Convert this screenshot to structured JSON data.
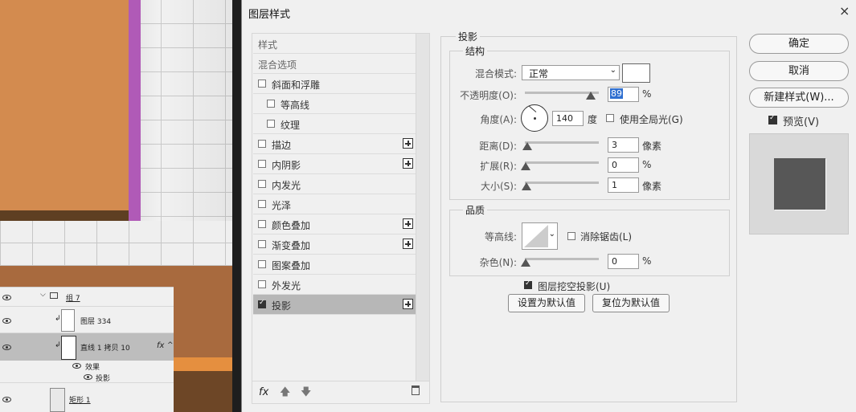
{
  "dialog": {
    "title": "图层样式",
    "close_glyph": "×"
  },
  "style_list": {
    "header": "样式",
    "blend_options": "混合选项",
    "items": [
      {
        "label": "斜面和浮雕",
        "checked": false,
        "plus": false,
        "indent": false
      },
      {
        "label": "等高线",
        "checked": false,
        "plus": false,
        "indent": true
      },
      {
        "label": "纹理",
        "checked": false,
        "plus": false,
        "indent": true
      },
      {
        "label": "描边",
        "checked": false,
        "plus": true,
        "indent": false
      },
      {
        "label": "内阴影",
        "checked": false,
        "plus": true,
        "indent": false
      },
      {
        "label": "内发光",
        "checked": false,
        "plus": false,
        "indent": false
      },
      {
        "label": "光泽",
        "checked": false,
        "plus": false,
        "indent": false
      },
      {
        "label": "颜色叠加",
        "checked": false,
        "plus": true,
        "indent": false
      },
      {
        "label": "渐变叠加",
        "checked": false,
        "plus": true,
        "indent": false
      },
      {
        "label": "图案叠加",
        "checked": false,
        "plus": false,
        "indent": false
      },
      {
        "label": "外发光",
        "checked": false,
        "plus": false,
        "indent": false
      },
      {
        "label": "投影",
        "checked": true,
        "plus": true,
        "indent": false,
        "selected": true
      }
    ],
    "footer_fx": "fx"
  },
  "drop_shadow": {
    "title": "投影",
    "structure_title": "结构",
    "blend_mode_label": "混合模式:",
    "blend_mode_value": "正常",
    "shadow_color": "#ffffff",
    "opacity_label": "不透明度(O):",
    "opacity_value": "89",
    "opacity_unit": "%",
    "angle_label": "角度(A):",
    "angle_value": "140",
    "angle_unit": "度",
    "global_light_label": "使用全局光(G)",
    "global_light_checked": false,
    "distance_label": "距离(D):",
    "distance_value": "3",
    "distance_unit": "像素",
    "spread_label": "扩展(R):",
    "spread_value": "0",
    "spread_unit": "%",
    "size_label": "大小(S):",
    "size_value": "1",
    "size_unit": "像素",
    "quality_title": "品质",
    "contour_label": "等高线:",
    "anti_alias_label": "消除锯齿(L)",
    "anti_alias_checked": false,
    "noise_label": "杂色(N):",
    "noise_value": "0",
    "noise_unit": "%",
    "knockout_label": "图层挖空投影(U)",
    "knockout_checked": true,
    "make_default": "设置为默认值",
    "reset_default": "复位为默认值"
  },
  "actions": {
    "ok": "确定",
    "cancel": "取消",
    "new_style": "新建样式(W)...",
    "preview_label": "预览(V)",
    "preview_checked": true
  },
  "layers": [
    {
      "name": "组 7",
      "kind": "group"
    },
    {
      "name": "图层 334",
      "kind": "layer"
    },
    {
      "name": "直线 1 拷贝 10",
      "kind": "layer",
      "selected": true,
      "fx": "fx"
    },
    {
      "name": "效果",
      "kind": "effect"
    },
    {
      "name": "投影",
      "kind": "effect"
    },
    {
      "name": "矩形 1",
      "kind": "layer"
    }
  ],
  "colors": {
    "orange_panel": "#d38b4f",
    "purple_edge": "#b05ab7",
    "brown": "#a86a3e",
    "selected_row": "#b7b7b7"
  }
}
